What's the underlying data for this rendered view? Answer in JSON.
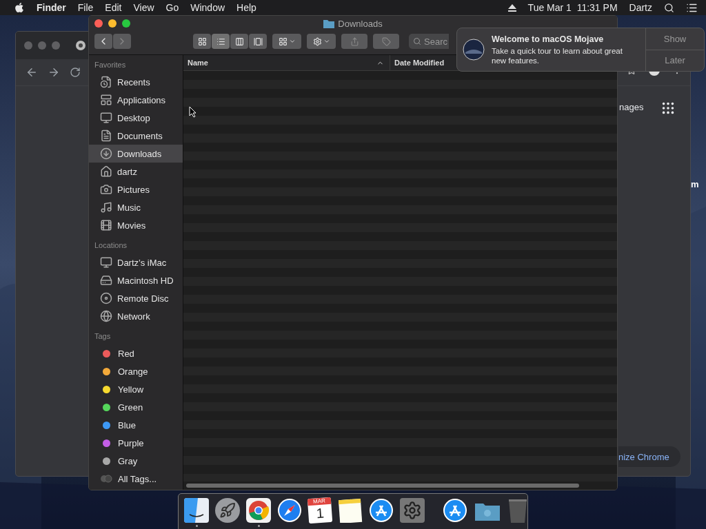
{
  "menu_bar": {
    "app_name": "Finder",
    "menus": [
      "File",
      "Edit",
      "View",
      "Go",
      "Window",
      "Help"
    ],
    "clock": "Tue Mar 1  11:31 PM",
    "user": "Dartz"
  },
  "desktop_text": "m",
  "browser_window": {
    "link_text": "nages",
    "customize_button": "nize Chrome"
  },
  "finder": {
    "title": "Downloads",
    "view_modes": [
      {
        "selected": false
      },
      {
        "selected": true
      },
      {
        "selected": false
      },
      {
        "selected": false
      }
    ],
    "search": {
      "placeholder": "Searc"
    },
    "sidebar": [
      {
        "heading": "Favorites",
        "items": [
          {
            "label": "Recents",
            "selected": false
          },
          {
            "label": "Applications",
            "selected": false
          },
          {
            "label": "Desktop",
            "selected": false
          },
          {
            "label": "Documents",
            "selected": false
          },
          {
            "label": "Downloads",
            "selected": true
          },
          {
            "label": "dartz",
            "selected": false
          },
          {
            "label": "Pictures",
            "selected": false
          },
          {
            "label": "Music",
            "selected": false
          },
          {
            "label": "Movies",
            "selected": false
          }
        ]
      },
      {
        "heading": "Locations",
        "items": [
          {
            "label": "Dartz’s iMac",
            "selected": false
          },
          {
            "label": "Macintosh HD",
            "selected": false
          },
          {
            "label": "Remote Disc",
            "selected": false
          },
          {
            "label": "Network",
            "selected": false
          }
        ]
      },
      {
        "heading": "Tags",
        "items": [
          {
            "label": "Red",
            "kind": "tag",
            "color": "#ec5b5b",
            "selected": false
          },
          {
            "label": "Orange",
            "kind": "tag",
            "color": "#f3a93a",
            "selected": false
          },
          {
            "label": "Yellow",
            "kind": "tag",
            "color": "#f6d92f",
            "selected": false
          },
          {
            "label": "Green",
            "kind": "tag",
            "color": "#55d65b",
            "selected": false
          },
          {
            "label": "Blue",
            "kind": "tag",
            "color": "#3d98f5",
            "selected": false
          },
          {
            "label": "Purple",
            "kind": "tag",
            "color": "#c35ee6",
            "selected": false
          },
          {
            "label": "Gray",
            "kind": "tag",
            "color": "#a8a8a8",
            "selected": false
          },
          {
            "label": "All Tags...",
            "kind": "all",
            "selected": false
          }
        ]
      }
    ],
    "columns": [
      {
        "label": "Name",
        "sorted": true
      },
      {
        "label": "Date Modified",
        "sorted": false
      }
    ]
  },
  "notification": {
    "title": "Welcome to macOS Mojave",
    "body": "Take a quick tour to learn about great new features.",
    "buttons": [
      "Show",
      "Later"
    ]
  },
  "dock": {
    "apps": [
      {
        "kind": "finder",
        "running": true
      },
      {
        "kind": "launchpad",
        "running": false
      },
      {
        "kind": "chrome",
        "running": true
      },
      {
        "kind": "safari",
        "running": false
      },
      {
        "kind": "calendar",
        "month": "MAR",
        "day": "1",
        "running": false
      },
      {
        "kind": "notes",
        "running": false
      },
      {
        "kind": "appstore",
        "running": false
      },
      {
        "kind": "settings",
        "running": false
      }
    ],
    "stacks": [
      {
        "kind": "appstore"
      },
      {
        "kind": "folder"
      },
      {
        "kind": "trash"
      }
    ]
  }
}
